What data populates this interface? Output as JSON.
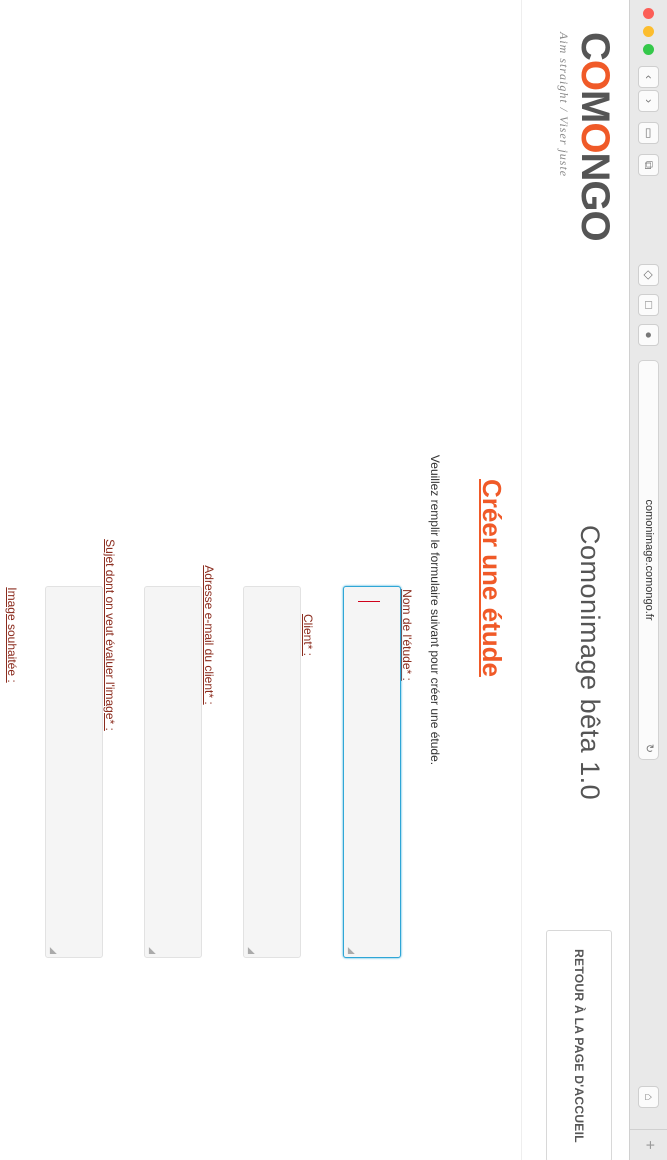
{
  "browser": {
    "address": "comonimage.comongo.fr",
    "reload_icon": "reload-icon",
    "new_tab_label": "+"
  },
  "header": {
    "logo_text": "COMONGO",
    "logo_part1": "C",
    "logo_part2": "O",
    "logo_part3": "M",
    "logo_part4": "O",
    "logo_part5": "NGO",
    "tagline": "Aim straight / Viser juste",
    "app_title": "Comonimage bêta 1.0",
    "home_button": "RETOUR À LA PAGE D'ACCUEIL"
  },
  "form": {
    "title": "Créer une étude",
    "intro": "Veuillez remplir le formulaire suivant pour créer une étude.",
    "fields": [
      {
        "label": "Nom de l'étude* :"
      },
      {
        "label": "Client* :"
      },
      {
        "label": "Adresse e-mail du client* :"
      },
      {
        "label": "Sujet dont on veut évaluer l'image* :"
      },
      {
        "label": "Image souhaitée :"
      }
    ]
  },
  "colors": {
    "accent": "#f05a28",
    "label": "#8b2c1e",
    "focus": "#2fa6d6"
  }
}
